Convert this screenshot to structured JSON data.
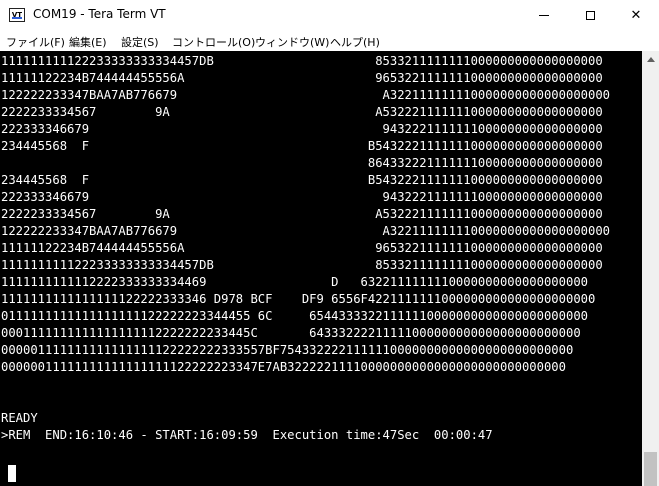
{
  "window": {
    "icon_text": "VT",
    "title": "COM19 - Tera Term VT",
    "close_glyph": "✕"
  },
  "menu": {
    "items": [
      "ファイル(F)",
      "編集(E)",
      "設定(S)",
      "コントロール(O)",
      "ウィンドウ(W)",
      "ヘルプ(H)"
    ]
  },
  "terminal": {
    "lines": [
      "111111111122233333333334457DB                      8533211111111000000000000000000",
      "11111122234B744444455556A                          9653221111111000000000000000000",
      "122222233347BAA7AB776679                            A322111111110000000000000000000",
      "2222233334567        9A                            A532221111111000000000000000000",
      "222333346679                                        943222111111100000000000000000",
      "234445568  F                                      B5432221111111000000000000000000",
      "                                                  86433222111111100000000000000000",
      "234445568  F                                      B5432221111111000000000000000000",
      "222333346679                                        943222111111100000000000000000",
      "2222233334567        9A                            A532221111111000000000000000000",
      "122222233347BAA7AB776679                            A322111111110000000000000000000",
      "11111122234B744444455556A                          9653221111111000000000000000000",
      "111111111122233333333334457DB                      8533211111111000000000000000000",
      "1111111111112222333333334469                 D   6322111111110000000000000000000",
      "1111111111111111122222333346 D978 BCF    DF9 6556F4221111111000000000000000000000",
      "0111111111111111111122222223344455 6C     65443333221111110000000000000000000000",
      "0001111111111111111112222222233445C       6433322221111100000000000000000000000",
      "000001111111111111111122222222333557BF7543322221111110000000000000000000000000",
      "00000011111111111111111122222223347E7AB32222211110000000000000000000000000000",
      "",
      "READY",
      ">REM  END:16:10:46 - START:16:09:59  Execution time:47Sec  00:00:47",
      "",
      ""
    ]
  }
}
